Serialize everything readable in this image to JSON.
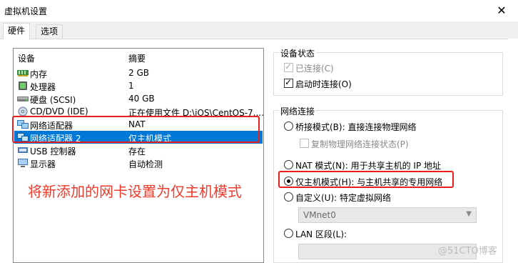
{
  "window": {
    "title": "虚拟机设置",
    "close_glyph": "✕"
  },
  "tabs": [
    {
      "label": "硬件",
      "active": true
    },
    {
      "label": "选项",
      "active": false
    }
  ],
  "device_list": {
    "headers": {
      "device": "设备",
      "summary": "摘要"
    },
    "rows": [
      {
        "name": "内存",
        "summary": "2 GB",
        "icon": "memory-icon"
      },
      {
        "name": "处理器",
        "summary": "1",
        "icon": "processor-icon"
      },
      {
        "name": "硬盘 (SCSI)",
        "summary": "40 GB",
        "icon": "harddisk-icon"
      },
      {
        "name": "CD/DVD (IDE)",
        "summary": "正在使用文件 D:\\iOS\\CentOS-7....",
        "icon": "cdrom-icon"
      },
      {
        "name": "网络适配器",
        "summary": "NAT",
        "icon": "network-adapter-icon"
      },
      {
        "name": "网络适配器 2",
        "summary": "仅主机模式",
        "icon": "network-adapter-icon"
      },
      {
        "name": "USB 控制器",
        "summary": "存在",
        "icon": "usb-icon"
      },
      {
        "name": "显示器",
        "summary": "自动检测",
        "icon": "display-icon"
      }
    ],
    "selected_index": 5
  },
  "annotation": "将新添加的网卡设置为仅主机模式",
  "device_status": {
    "label": "设备状态",
    "connected": {
      "label": "已连接(C)",
      "checked": true,
      "disabled": true
    },
    "connect_at_power_on": {
      "label": "启动时连接(O)",
      "checked": true,
      "disabled": false
    }
  },
  "network_connection": {
    "label": "网络连接",
    "bridged": {
      "label": "桥接模式(B): 直接连接物理网络",
      "selected": false
    },
    "replicate": {
      "label": "复制物理网络连接状态(P)",
      "checked": false,
      "disabled": true
    },
    "nat": {
      "label": "NAT 模式(N): 用于共享主机的 IP 地址",
      "selected": false
    },
    "host_only": {
      "label": "仅主机模式(H): 与主机共享的专用网络",
      "selected": true
    },
    "custom": {
      "label": "自定义(U): 特定虚拟网络",
      "selected": false
    },
    "vmnet_value": "VMnet0",
    "lan_segment": {
      "label": "LAN 区段(L):",
      "selected": false
    }
  },
  "watermark": "@51CTO博客",
  "colors": {
    "selection": "#0078d7",
    "highlight_red": "#e81f1f",
    "annotation_red": "#ef3b2c"
  }
}
